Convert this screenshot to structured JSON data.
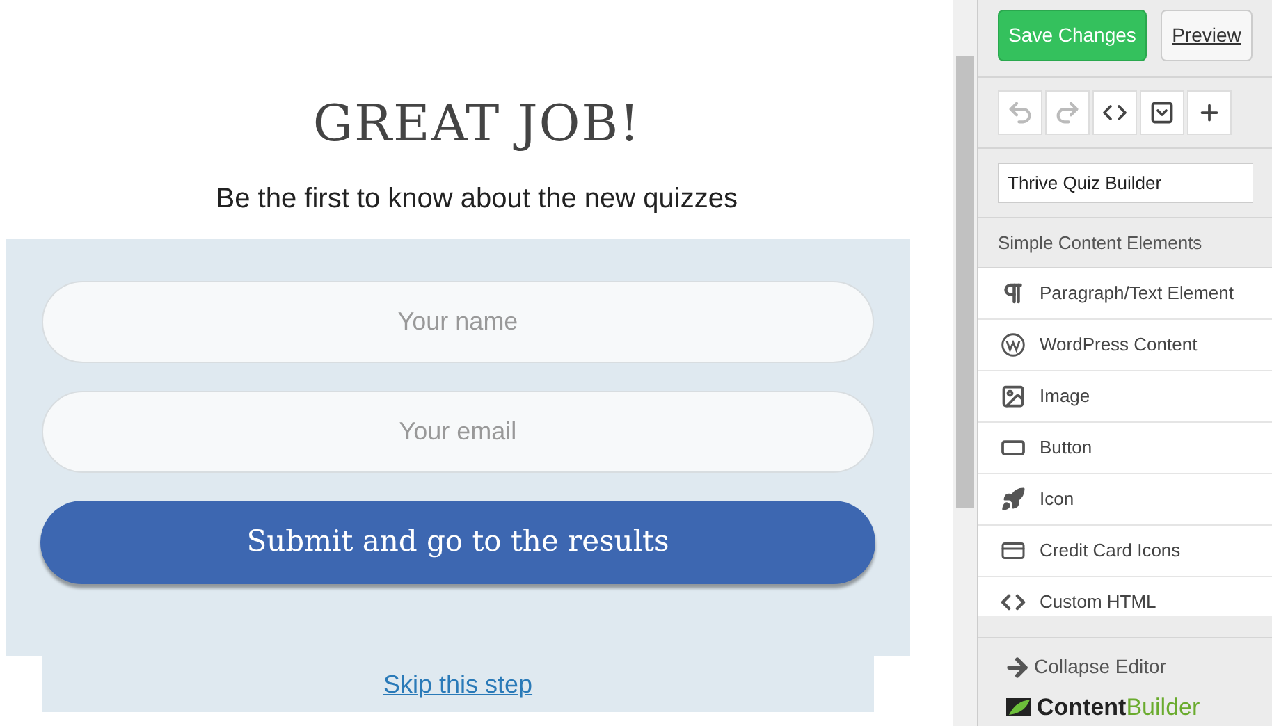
{
  "form": {
    "title": "GREAT JOB!",
    "subtitle": "Be the first to know about the new quizzes",
    "fields": [
      {
        "placeholder": "Your name"
      },
      {
        "placeholder": "Your email"
      }
    ],
    "submit": "Submit and go to the results",
    "skip_link": "Skip this step"
  },
  "sidebar": {
    "save": "Save Changes",
    "preview": "Preview",
    "toolbar": [
      {
        "kind": "undo",
        "disabled": true
      },
      {
        "kind": "redo",
        "disabled": true
      },
      {
        "kind": "code",
        "disabled": false
      },
      {
        "kind": "dropdown",
        "disabled": false
      },
      {
        "kind": "plus",
        "disabled": false
      }
    ],
    "select_value": "Thrive Quiz Builder",
    "section": "Simple Content Elements",
    "elements": [
      {
        "kind": "paragraph",
        "label": "Paragraph/Text Element"
      },
      {
        "kind": "wordpress",
        "label": "WordPress Content"
      },
      {
        "kind": "image",
        "label": "Image"
      },
      {
        "kind": "button",
        "label": "Button"
      },
      {
        "kind": "rocket",
        "label": "Icon"
      },
      {
        "kind": "card",
        "label": "Credit Card Icons"
      },
      {
        "kind": "code",
        "label": "Custom HTML"
      }
    ],
    "collapse": "Collapse Editor",
    "brand": {
      "first": "Content",
      "second": "Builder"
    }
  }
}
